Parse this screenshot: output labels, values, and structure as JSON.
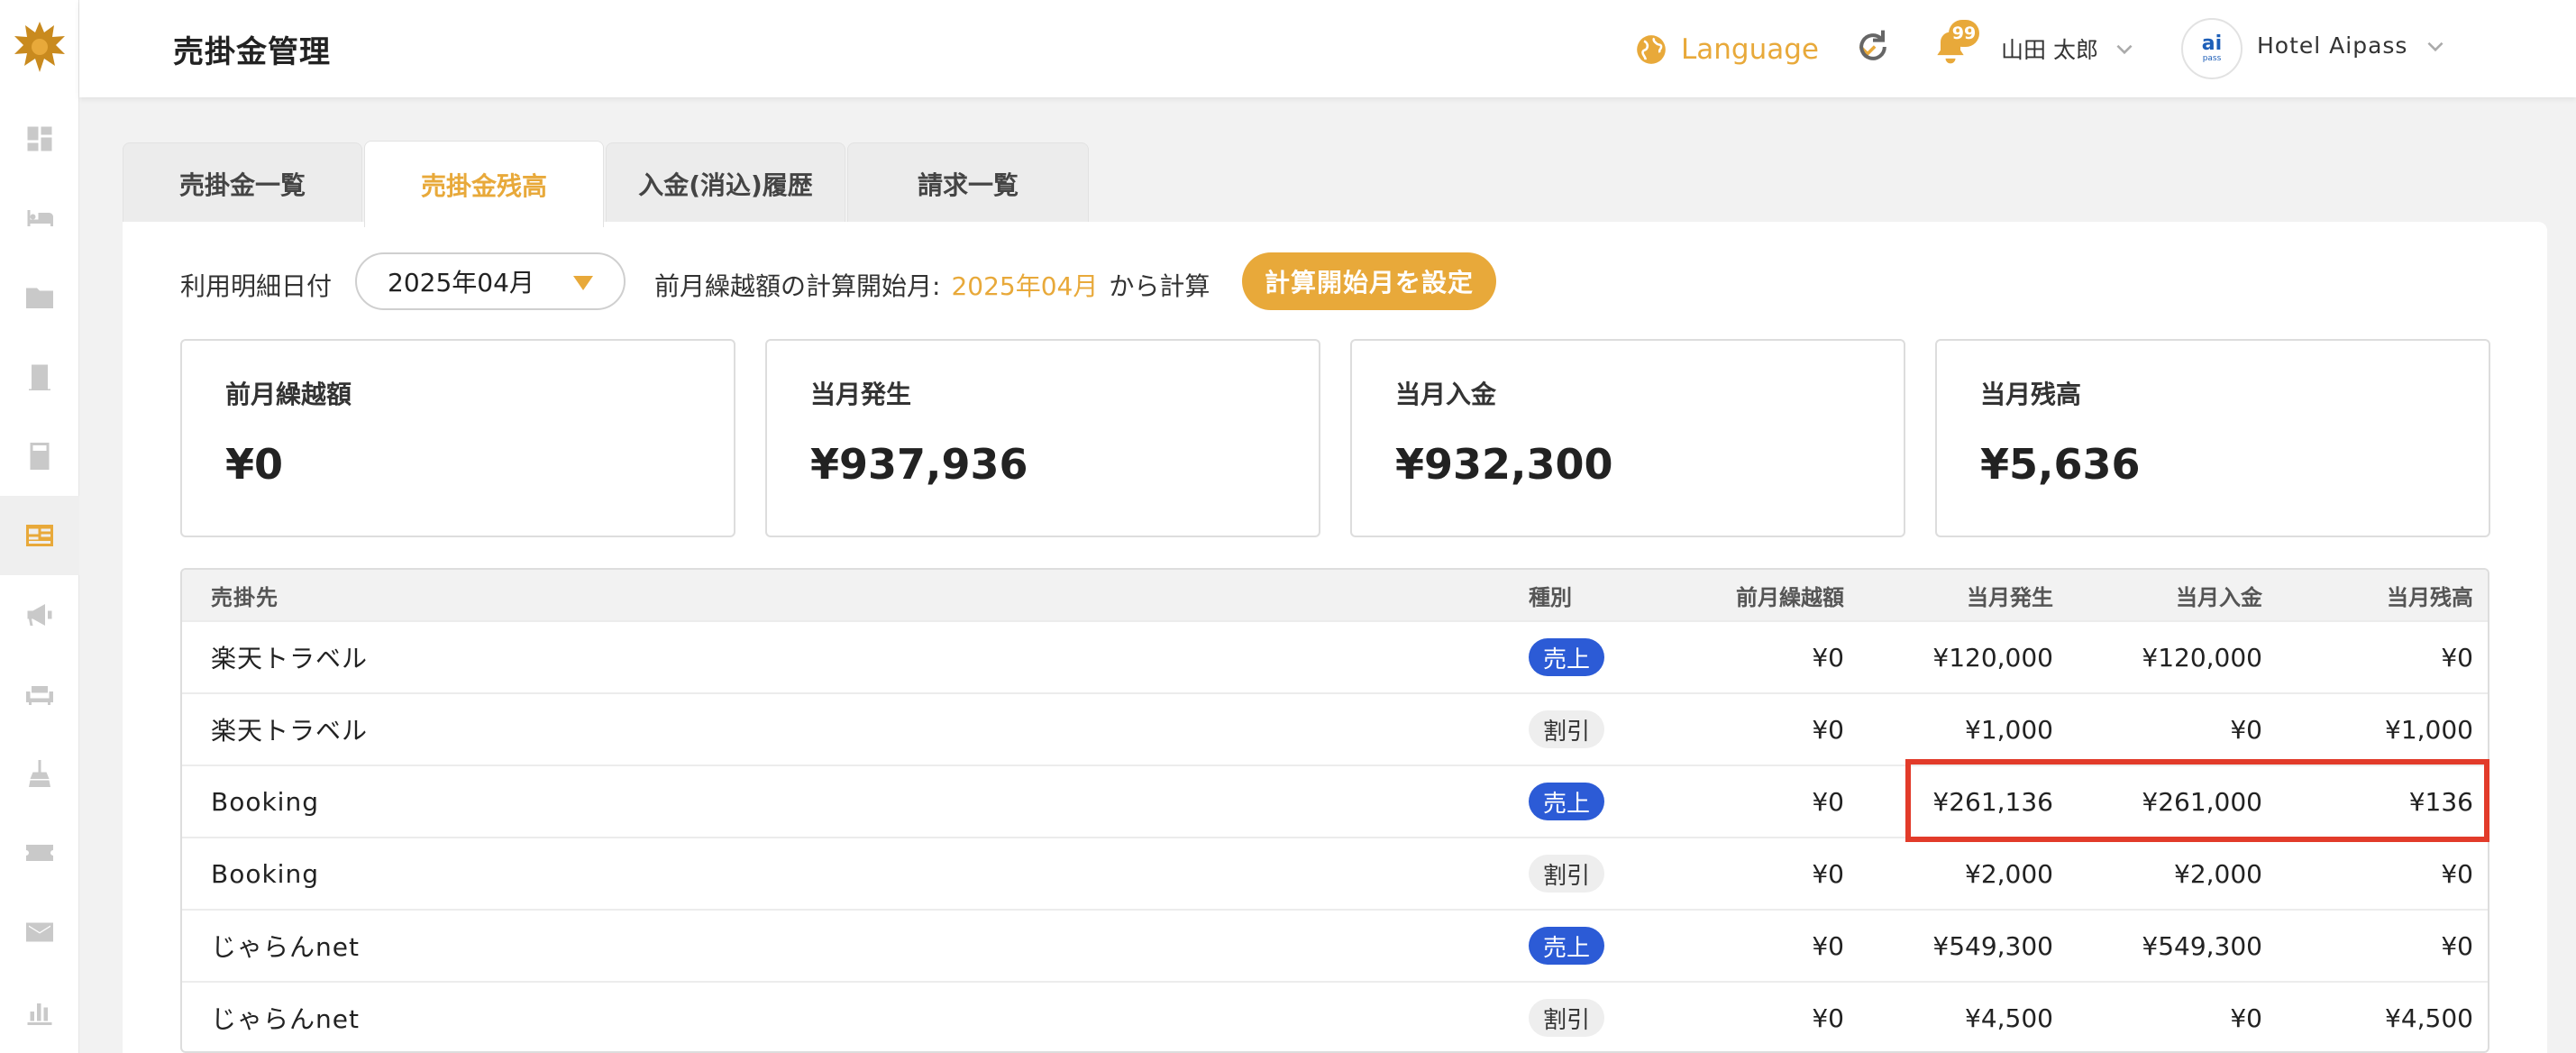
{
  "header": {
    "title": "売掛金管理",
    "language_label": "Language",
    "notification_count": "99",
    "user_name": "山田 太郎",
    "hotel_avatar_text": "ai",
    "hotel_avatar_sub": "pass",
    "hotel_name": "Hotel Aipass"
  },
  "sidebar": {
    "items": [
      {
        "icon": "dashboard-icon",
        "active": false
      },
      {
        "icon": "bed-icon",
        "active": false
      },
      {
        "icon": "folder-user-icon",
        "active": false
      },
      {
        "icon": "door-icon",
        "active": false
      },
      {
        "icon": "calculator-icon",
        "active": false
      },
      {
        "icon": "receivables-icon",
        "active": true
      },
      {
        "icon": "megaphone-icon",
        "active": false
      },
      {
        "icon": "sofa-icon",
        "active": false
      },
      {
        "icon": "broom-icon",
        "active": false
      },
      {
        "icon": "ticket-icon",
        "active": false
      },
      {
        "icon": "mail-icon",
        "active": false
      },
      {
        "icon": "bar-chart-icon",
        "active": false
      }
    ]
  },
  "tabs": [
    {
      "label": "売掛金一覧",
      "active": false
    },
    {
      "label": "売掛金残高",
      "active": true
    },
    {
      "label": "入金(消込)履歴",
      "active": false
    },
    {
      "label": "請求一覧",
      "active": false
    }
  ],
  "filter": {
    "date_label": "利用明細日付",
    "selected_month": "2025年04月",
    "calc_prefix": "前月繰越額の計算開始月:",
    "calc_month": "2025年04月",
    "calc_suffix": "から計算",
    "set_button": "計算開始月を設定"
  },
  "summary": [
    {
      "label": "前月繰越額",
      "value": "¥0"
    },
    {
      "label": "当月発生",
      "value": "¥937,936"
    },
    {
      "label": "当月入金",
      "value": "¥932,300"
    },
    {
      "label": "当月残高",
      "value": "¥5,636"
    }
  ],
  "table": {
    "headers": {
      "name": "売掛先",
      "type": "種別",
      "prev": "前月繰越額",
      "occurred": "当月発生",
      "deposit": "当月入金",
      "balance": "当月残高"
    },
    "rows": [
      {
        "name": "楽天トラベル",
        "type": "売上",
        "kind": "sales",
        "prev": "¥0",
        "occurred": "¥120,000",
        "deposit": "¥120,000",
        "balance": "¥0"
      },
      {
        "name": "楽天トラベル",
        "type": "割引",
        "kind": "discount",
        "prev": "¥0",
        "occurred": "¥1,000",
        "deposit": "¥0",
        "balance": "¥1,000"
      },
      {
        "name": "Booking",
        "type": "売上",
        "kind": "sales",
        "prev": "¥0",
        "occurred": "¥261,136",
        "deposit": "¥261,000",
        "balance": "¥136"
      },
      {
        "name": "Booking",
        "type": "割引",
        "kind": "discount",
        "prev": "¥0",
        "occurred": "¥2,000",
        "deposit": "¥2,000",
        "balance": "¥0"
      },
      {
        "name": "じゃらんnet",
        "type": "売上",
        "kind": "sales",
        "prev": "¥0",
        "occurred": "¥549,300",
        "deposit": "¥549,300",
        "balance": "¥0"
      },
      {
        "name": "じゃらんnet",
        "type": "割引",
        "kind": "discount",
        "prev": "¥0",
        "occurred": "¥4,500",
        "deposit": "¥0",
        "balance": "¥4,500"
      }
    ]
  },
  "colors": {
    "accent": "#e8a93a",
    "sales_badge": "#2c5bd6",
    "highlight": "#e23b2a"
  }
}
